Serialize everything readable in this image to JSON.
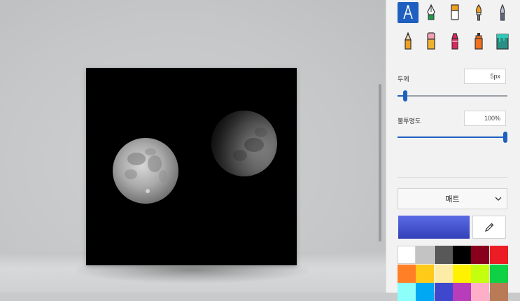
{
  "panel": {
    "thickness_label": "두께",
    "thickness_value": "5px",
    "thickness_level": 0.05,
    "opacity_label": "불투명도",
    "opacity_value": "100%",
    "opacity_level": 1.0,
    "texture_dropdown": "매트",
    "current_color": "#4453d0"
  },
  "brushes": [
    {
      "name": "calligraphy-pen-icon",
      "selected": true
    },
    {
      "name": "fountain-pen-icon",
      "selected": false
    },
    {
      "name": "marker-icon",
      "selected": false
    },
    {
      "name": "oil-brush-icon",
      "selected": false
    },
    {
      "name": "watercolor-brush-icon",
      "selected": false
    },
    {
      "name": "pencil-icon",
      "selected": false
    },
    {
      "name": "eraser-icon",
      "selected": false
    },
    {
      "name": "crayon-icon",
      "selected": false
    },
    {
      "name": "spray-can-icon",
      "selected": false
    },
    {
      "name": "pixel-pen-icon",
      "selected": false
    }
  ],
  "palette": [
    "#ffffff",
    "#c3c3c3",
    "#585858",
    "#000000",
    "#88001b",
    "#ec1c24",
    "#ff7f27",
    "#ffca18",
    "#fdeca6",
    "#fff200",
    "#c4ff0e",
    "#0ed145",
    "#8cfffb",
    "#00a8f3",
    "#3f48cc",
    "#b83dba",
    "#ffaec8",
    "#b97a56"
  ]
}
